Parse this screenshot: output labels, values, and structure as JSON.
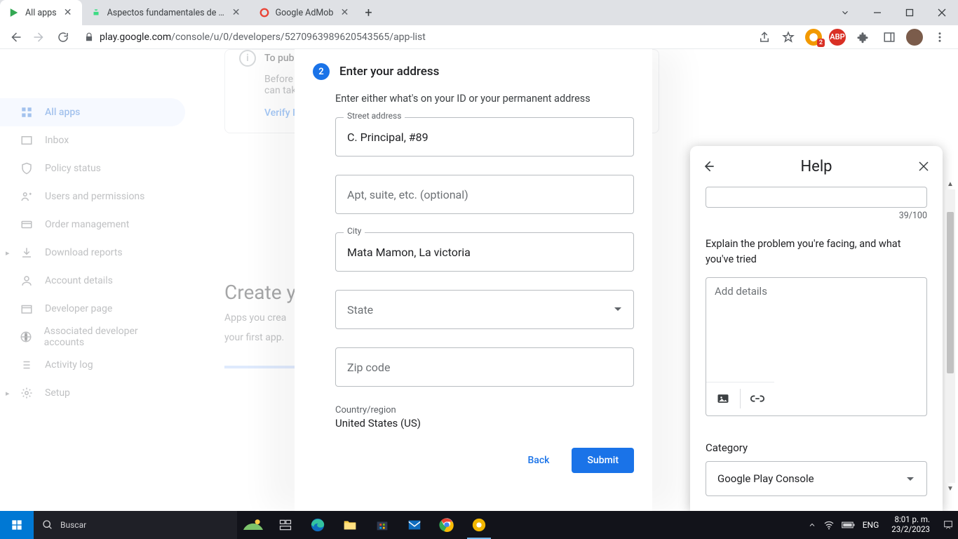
{
  "browser": {
    "tabs": [
      {
        "title": "All apps"
      },
      {
        "title": "Aspectos fundamentales de la ap"
      },
      {
        "title": "Google AdMob"
      }
    ],
    "url_host": "play.google.com",
    "url_path": "/console/u/0/developers/5270963989620543565/app-list"
  },
  "sidebar": {
    "items": [
      {
        "label": "All apps"
      },
      {
        "label": "Inbox"
      },
      {
        "label": "Policy status"
      },
      {
        "label": "Users and permissions"
      },
      {
        "label": "Order management"
      },
      {
        "label": "Download reports"
      },
      {
        "label": "Account details"
      },
      {
        "label": "Developer page"
      },
      {
        "label": "Associated developer accounts"
      },
      {
        "label": "Activity log"
      },
      {
        "label": "Setup"
      }
    ]
  },
  "bg": {
    "verify_title": "To pub",
    "verify_body": "Before",
    "verify_body2": "can tak",
    "verify_link": "Verify I",
    "headline": "Create yo",
    "sub": "Apps you crea",
    "sub2": "your first app."
  },
  "modal": {
    "step_num": "2",
    "step_title": "Enter your address",
    "desc": "Enter either what's on your ID or your permanent address",
    "street_label": "Street address",
    "street_value": "C. Principal, #89",
    "apt_placeholder": "Apt, suite, etc. (optional)",
    "city_label": "City",
    "city_value": "Mata Mamon, La victoria",
    "state_placeholder": "State",
    "zip_placeholder": "Zip code",
    "country_label": "Country/region",
    "country_value": "United States (US)",
    "back": "Back",
    "submit": "Submit"
  },
  "help": {
    "title": "Help",
    "counter": "39/100",
    "explain": "Explain the problem you're facing, and what you've tried",
    "details_placeholder": "Add details",
    "category_label": "Category",
    "category_value": "Google Play Console"
  },
  "taskbar": {
    "search_placeholder": "Buscar",
    "lang": "ENG",
    "time": "8:01 p. m.",
    "date": "23/2/2023"
  }
}
